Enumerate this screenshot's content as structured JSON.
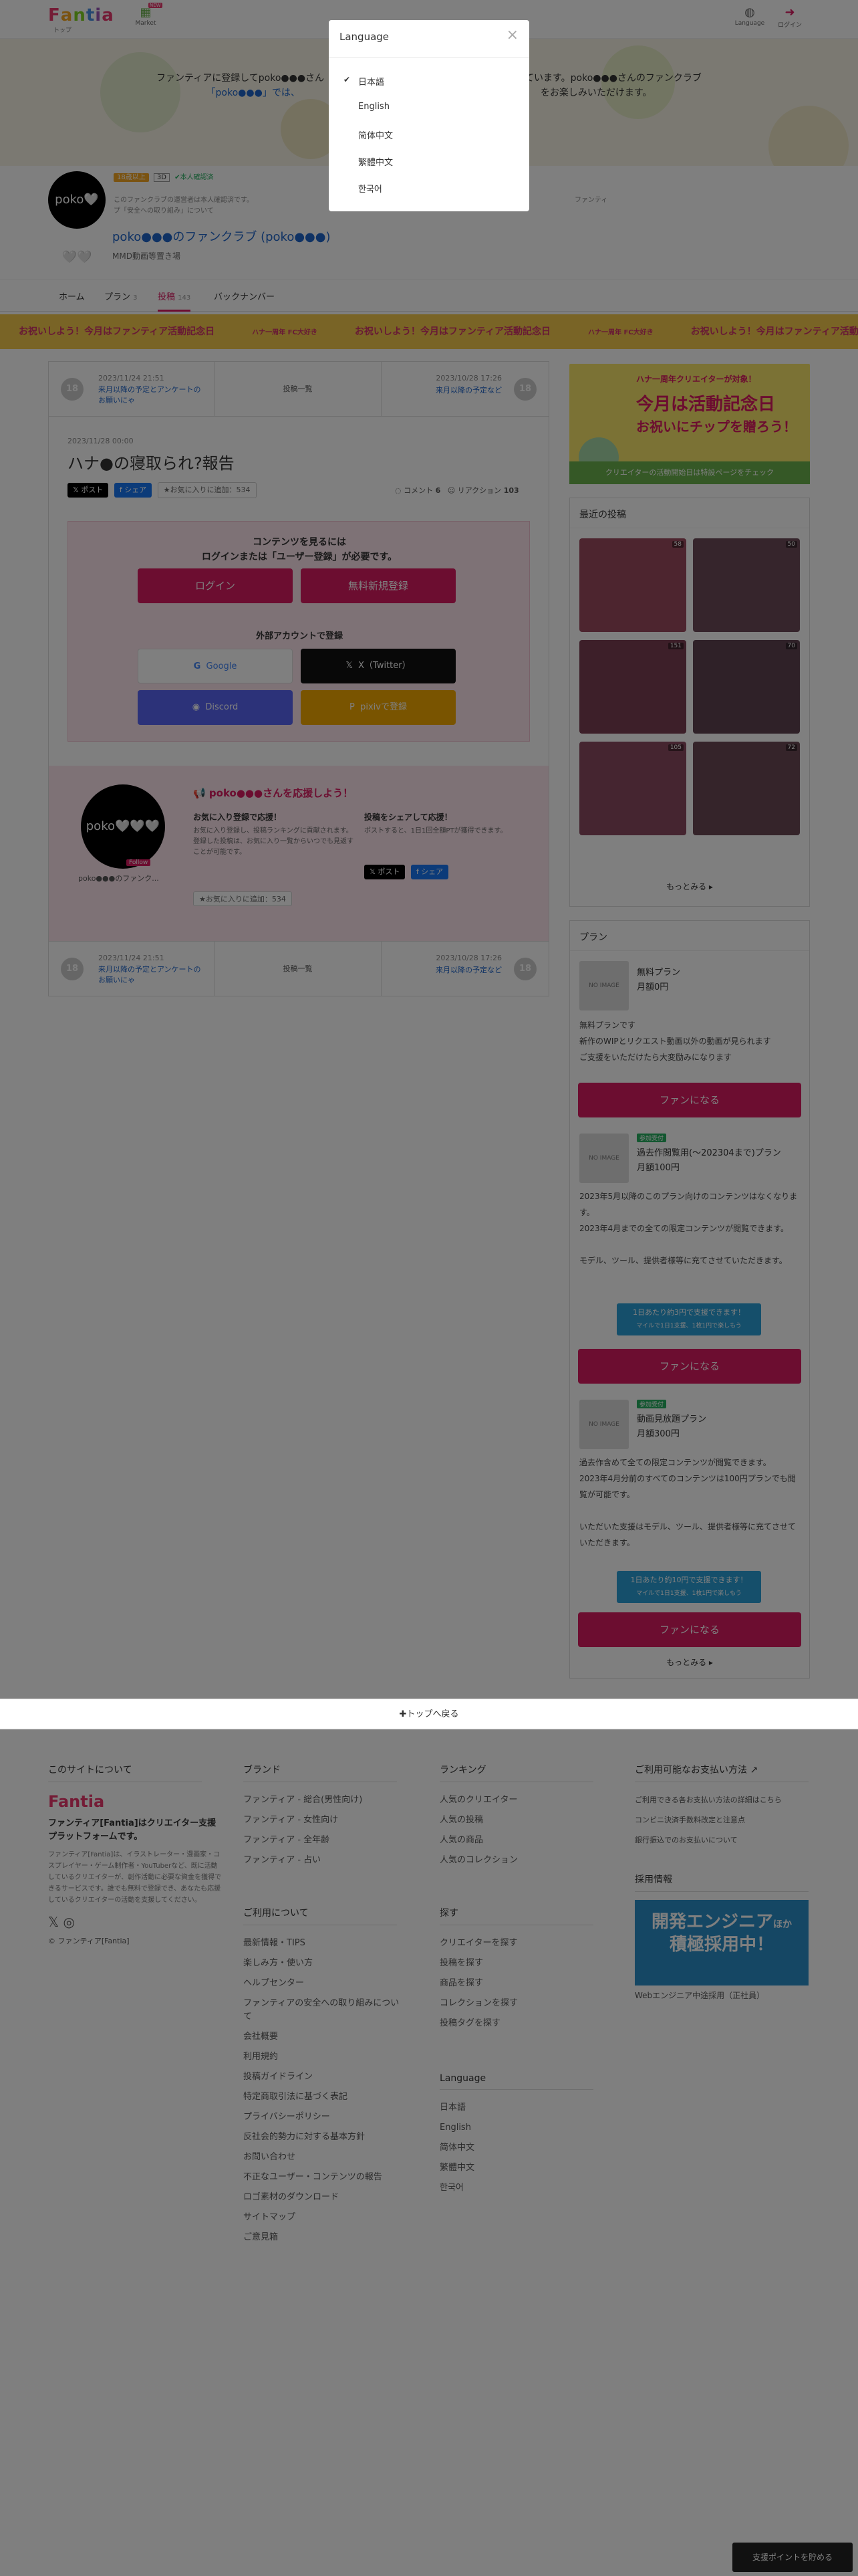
{
  "header": {
    "logo": "Fantia",
    "nav_top": "トップ",
    "nav_market": "Market",
    "nav_market_badge": "NEW",
    "language": "Language",
    "login": "ログイン"
  },
  "banner": {
    "line1_a": "ファンティアに登録してpoko●●●さん",
    "line1_b": "ています。poko●●●さんのファンクラブ",
    "line2_a": "「poko●●●」では、",
    "line2_b": "をお楽しみいただけます。"
  },
  "profile": {
    "badge_age": "18歳以上",
    "badge_r18": "3D",
    "badge_verified": "本人確認済",
    "desc": "このファンクラブの運営者は本人確認済です。",
    "desc2": "プ「安全への取り組み」について",
    "title": "poko●●●のファンクラブ (poko●●●)",
    "subtitle": "MMD動画等置き場",
    "avatar_text": "poko🤍🤍🤍",
    "follow_label": "ファンティ"
  },
  "tabs": [
    {
      "label": "ホーム",
      "count": ""
    },
    {
      "label": "プラン",
      "count": "3"
    },
    {
      "label": "投稿",
      "count": "143"
    },
    {
      "label": "バックナンバー",
      "count": ""
    }
  ],
  "strip_text": "お祝いしよう！今月はファンティア活動記念日",
  "strip_small": "ハナ一周年 FC大好き",
  "post": {
    "prev_date": "2023/11/24 21:51",
    "prev_title": "来月以降の予定とアンケートのお願いにゃ",
    "list_label": "投稿一覧",
    "next_date": "2023/10/28 17:26",
    "next_title": "来月以降の予定など",
    "age_mark": "18",
    "date": "2023/11/28 00:00",
    "title": "ハナ●の寝取られ?報告",
    "btn_post": "ポスト",
    "btn_share": "シェア",
    "btn_fav": "お気に入りに追加",
    "fav_count": "534",
    "comment_label": "コメント",
    "comment_count": "6",
    "reaction_label": "リアクション",
    "reaction_count": "103"
  },
  "login_box": {
    "line1": "コンテンツを見るには",
    "line2": "ログインまたは「ユーザー登録」が必要です。",
    "login_btn": "ログイン",
    "register_btn": "無料新規登録",
    "ext_title": "外部アカウントで登録",
    "google": "Google",
    "twitter": "X（Twitter）",
    "discord": "Discord",
    "pixiv": "pixivで登録"
  },
  "support": {
    "title": "poko●●●さんを応援しよう！",
    "fav_title": "お気に入り登録で応援！",
    "fav_desc": "お気に入り登録し、投稿ランキングに貢献されます。登録した投稿は、お気に入り一覧からいつでも見返すことが可能です。",
    "fav_btn": "お気に入りに追加：534",
    "share_title": "投稿をシェアして応援！",
    "share_desc": "ポストすると、1日1回全額PTが獲得できます。",
    "btn_post": "ポスト",
    "btn_share": "シェア",
    "avatar_name": "poko●●●のファンク...",
    "follow": "Follow"
  },
  "sidebar": {
    "ad_line1": "ハナ一周年クリエイターが対象！",
    "ad_line2": "今月は活動記念日",
    "ad_line3": "お祝いにチップを贈ろう！",
    "ad_line4": "クリエイターの活動開始日は特設ページをチェック",
    "recent_title": "最近の投稿",
    "recent_badges": [
      "58",
      "50",
      "151",
      "70",
      "105",
      "72"
    ],
    "more": "もっとみる",
    "plan_title": "プラン",
    "plans": [
      {
        "name": "無料プラン",
        "price": "月額0円",
        "badge": "",
        "desc": [
          "無料プランです",
          "新作のWIPとリクエスト動画以外の動画が見られます",
          "ご支援をいただけたら大変励みになります"
        ],
        "note": "",
        "note2": "",
        "btn": "ファンになる"
      },
      {
        "name": "過去作閲覧用(～202304まで)プラン",
        "price": "月額100円",
        "badge": "参加受付",
        "desc": [
          "2023年5月以降のこのプラン向けのコンテンツはなくなります。",
          "2023年4月までの全ての限定コンテンツが閲覧できます。",
          "",
          "モデル、ツール、提供者様等に充てさせていただきます。"
        ],
        "note": "1日あたり約3円で支援できます！",
        "note2": "マイルで1日1支援、1枚1円で楽しもう",
        "btn": "ファンになる"
      },
      {
        "name": "動画見放題プラン",
        "price": "月額300円",
        "badge": "参加受付",
        "desc": [
          "過去作含めて全ての限定コンテンツが閲覧できます。",
          "2023年4月分前のすべてのコンテンツは100円プランでも閲覧が可能です。",
          "",
          "いただいた支援はモデル、ツール、提供者様等に充てさせていただきます。"
        ],
        "note": "1日あたり約10円で支援できます！",
        "note2": "マイルで1日1支援、1枚1円で楽しもう",
        "btn": "ファンになる"
      }
    ]
  },
  "back_to_top": "トップへ戻る",
  "footer": {
    "about_title": "このサイトについて",
    "about_logo": "Fantia",
    "about_tag": "ファンティア[Fantia]はクリエイター支援プラットフォームです。",
    "about_desc": "ファンティア[Fantia]は、イラストレーター・漫画家・コスプレイヤー・ゲーム制作者・YouTuberなど、既に活動しているクリエイターが、創作活動に必要な資金を獲得できるサービスです。誰でも無料で登録でき、あなたも応援しているクリエイターの活動を支援してください。",
    "copyright": "© ファンティア[Fantia]",
    "brand_title": "ブランド",
    "brand": [
      "ファンティア - 総合(男性向け)",
      "ファンティア - 女性向け",
      "ファンティア - 全年齢",
      "ファンティア - 占い"
    ],
    "usage_title": "ご利用について",
    "usage": [
      "最新情報・TIPS",
      "楽しみ方・使い方",
      "ヘルプセンター",
      "ファンティアの安全への取り組みについて",
      "会社概要",
      "利用規約",
      "投稿ガイドライン",
      "特定商取引法に基づく表記",
      "プライバシーポリシー",
      "反社会的勢力に対する基本方針",
      "お問い合わせ",
      "不正なユーザー・コンテンツの報告",
      "ロゴ素材のダウンロード",
      "サイトマップ",
      "ご意見箱"
    ],
    "ranking_title": "ランキング",
    "ranking": [
      "人気のクリエイター",
      "人気の投稿",
      "人気の商品",
      "人気のコレクション"
    ],
    "search_title": "探す",
    "search": [
      "クリエイターを探す",
      "投稿を探す",
      "商品を探す",
      "コレクションを探す",
      "投稿タグを探す"
    ],
    "lang_title": "Language",
    "langs": [
      "日本語",
      "English",
      "简体中文",
      "繁體中文",
      "한국어"
    ],
    "pay_title": "ご利用可能なお支払い方法",
    "pay": [
      "ご利用できる各お支払い方法の詳細はこちら",
      "コンビニ決済手数料改定と注意点",
      "銀行振込でのお支払いについて"
    ],
    "recruit_title": "採用情報",
    "recruit_banner1": "開発エンジニア",
    "recruit_banner2": "ほか",
    "recruit_banner3": "積極採用中！",
    "recruit_caption": "Webエンジニア中途採用（正社員）"
  },
  "bottom_bar": "支援ポイントを貯める",
  "modal": {
    "title": "Language",
    "close": "×",
    "options": [
      "日本語",
      "English",
      "简体中文",
      "繁體中文",
      "한국어"
    ],
    "selected": "日本語"
  }
}
